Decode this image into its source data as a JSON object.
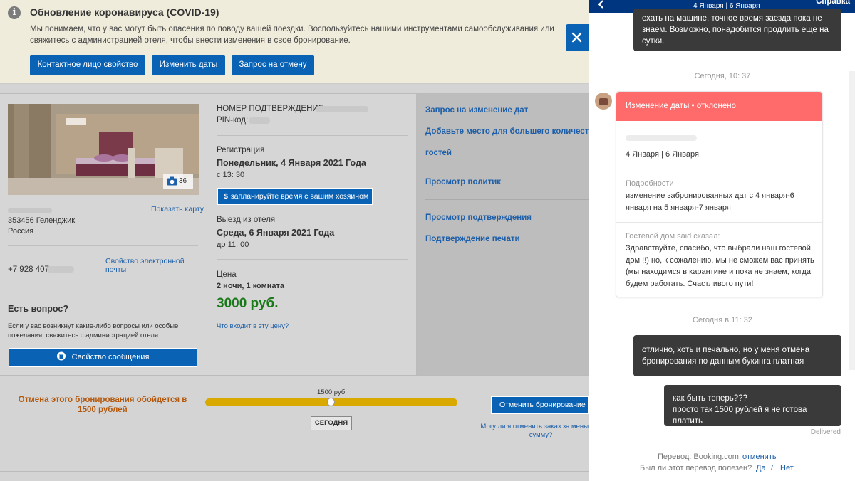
{
  "banner": {
    "icon": "info-icon",
    "title": "Обновление коронавируса (COVID-19)",
    "text": "Мы понимаем, что у вас могут быть опасения по поводу вашей поездки. Воспользуйтесь нашими инструментами самообслуживания или свяжитесь с администрацией отеля, чтобы внести изменения в свое бронирование.",
    "buttons": [
      "Контактное лицо свойство",
      "Изменить даты",
      "Запрос на отмену"
    ]
  },
  "hotel": {
    "photo_count": "36",
    "show_map": "Показать карту",
    "address_line": "353456 Геленджик",
    "country": "Россия",
    "email_link": "Свойство электронной почты",
    "phone": "+7 928 407",
    "question_title": "Есть вопрос?",
    "question_text": "Если у вас возникнут какие-либо вопросы или особые пожелания, свяжитесь с администрацией отеля.",
    "message_button": "Свойство сообщения"
  },
  "booking": {
    "confirmation_label": "НОМЕР ПОДТВЕРЖДЕНИЯ:",
    "pin_label": "PIN-код:",
    "checkin_label": "Регистрация",
    "checkin_date": "Понедельник, 4 Января 2021 Года",
    "checkin_time": "с 13: 30",
    "schedule_button": "запланируйте время с вашим хозяином",
    "schedule_icon": "$",
    "checkout_label": "Выезд из отеля",
    "checkout_date": "Среда, 6 Января 2021 Года",
    "checkout_time": "до 11: 00",
    "price_label": "Цена",
    "price_desc": "2 ночи, 1 комната",
    "price": "3000 руб.",
    "price_link": "Что входит в эту цену?"
  },
  "actions": [
    "Запрос на изменение дат",
    "Добавьте место для большего количества",
    "гостей",
    "Просмотр политик",
    "Просмотр подтверждения",
    "Подтверждение печати"
  ],
  "cancel": {
    "text": "Отмена этого бронирования обойдется в 1500 рублей",
    "slider_value": "1500 руб.",
    "today_label": "СЕГОДНЯ",
    "cancel_button": "Отменить бронирование",
    "cancel_question": "Могу ли я отменить заказ за меньшую сумму?"
  },
  "chat": {
    "header_dates": "4 Января | 6 Января",
    "help": "Справка",
    "close_icon": "close-icon",
    "msg_top": "ехать на машине, точное время заезда пока не знаем. Возможно, понадобится продлить еще на сутки.",
    "ts1": "Сегодня, 10: 37",
    "card_title": "Изменение даты • отклонено",
    "card_dates": "4 Января | 6 Января",
    "details_label": "Подробности",
    "details_text": "изменение забронированных дат с 4 января-6 января на 5 января-7 января",
    "guest_label": "Гостевой дом said сказал:",
    "guest_text": "Здравствуйте, спасибо, что выбрали наш гостевой дом !!) но, к сожалению, мы не сможем вас принять (мы находимся в карантине и пока не знаем, когда будем работать. Счастливого пути!",
    "ts2": "Сегодня в 11: 32",
    "msg1": "отлично, хоть и печально, но у меня отмена бронирования по данным букинга платная",
    "msg2_line1": "как быть теперь???",
    "msg2_line2": "просто так 1500 рублей я не готова платить",
    "delivered": "Delivered",
    "translation_label": "Перевод: Booking.com",
    "translation_cancel": "отменить",
    "useful_q": "Был ли этот перевод полезен?",
    "yes": "Да",
    "slash": "/",
    "no": "Нет"
  },
  "colors": {
    "primary": "#0a62b4",
    "declined": "#ff6b6b",
    "price": "#1a7a1a",
    "cancel_text": "#b4580c",
    "slider": "#d9a900"
  }
}
